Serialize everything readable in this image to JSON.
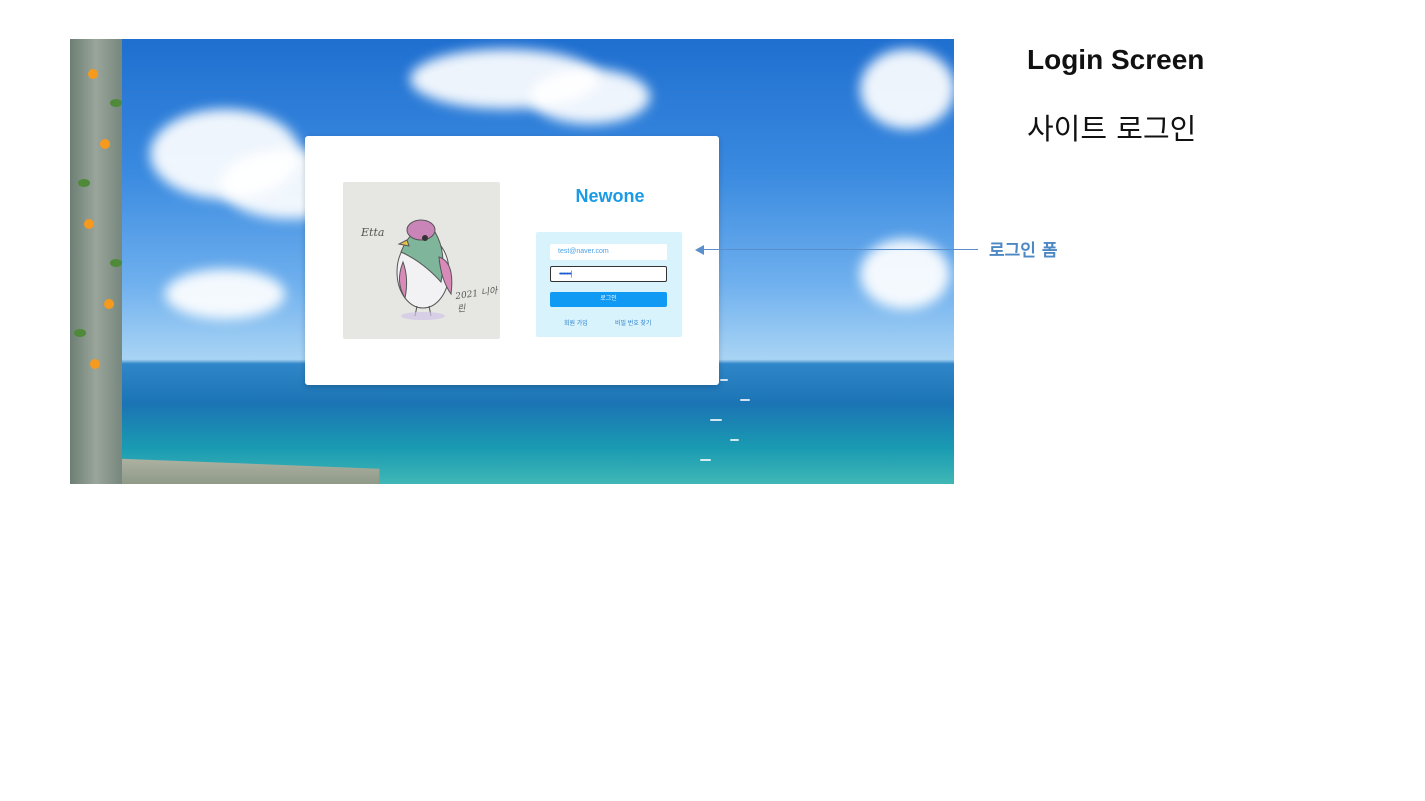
{
  "annotation": {
    "title": "Login Screen",
    "subtitle": "사이트 로그인",
    "callout_label": "로그인 폼"
  },
  "login_card": {
    "brand": "Newone",
    "email_value": "test@naver.com",
    "password_value": "••••••••|",
    "login_button": "로그인",
    "signup_link": "회원 가입",
    "find_password_link": "비밀 번호 찾기",
    "illustration_signature": "Etta",
    "illustration_signature_2": "2021 니아린"
  },
  "colors": {
    "brand": "#1a9be6",
    "button": "#119af4",
    "form_background": "#d8f3fb",
    "callout": "#4d88c4"
  }
}
